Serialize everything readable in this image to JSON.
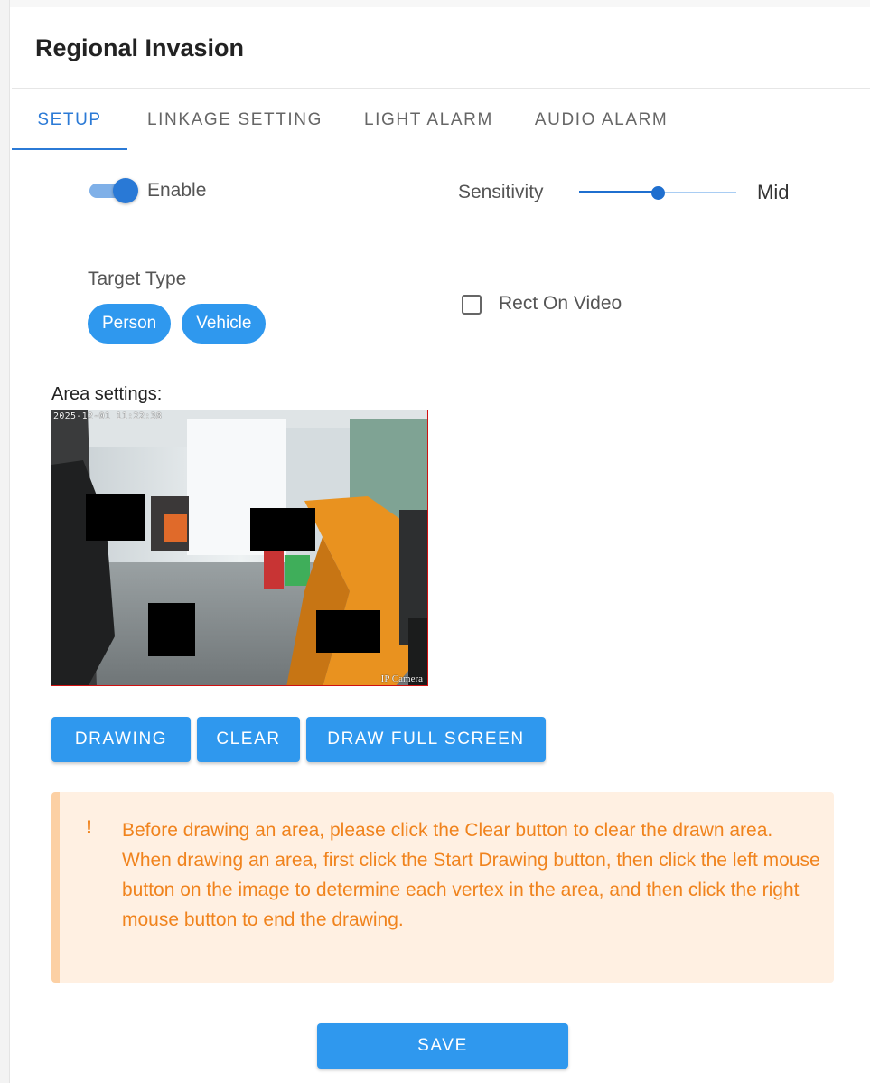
{
  "header": {
    "title": "Regional Invasion"
  },
  "tabs": [
    {
      "label": "SETUP",
      "active": true
    },
    {
      "label": "LINKAGE SETTING",
      "active": false
    },
    {
      "label": "LIGHT ALARM",
      "active": false
    },
    {
      "label": "AUDIO ALARM",
      "active": false
    }
  ],
  "setup": {
    "enable_label": "Enable",
    "enabled": true,
    "sensitivity_label": "Sensitivity",
    "sensitivity_value": "Mid",
    "sensitivity_level": 0.5,
    "target_type_label": "Target Type",
    "targets": [
      "Person",
      "Vehicle"
    ],
    "rect_on_video_label": "Rect On Video",
    "rect_on_video_checked": false,
    "area_settings_label": "Area settings:"
  },
  "video": {
    "timestamp": "2025-12-01 11:22:38",
    "camera_label": "IP Camera"
  },
  "buttons": {
    "drawing": "DRAWING",
    "clear": "CLEAR",
    "draw_full_screen": "DRAW FULL SCREEN",
    "save": "SAVE"
  },
  "alert": {
    "icon": "!",
    "line1": "Before drawing an area, please click the Clear button to clear the drawn area.",
    "line2": "When drawing an area, first click the Start Drawing button, then click the left mouse button on the image to determine each vertex in the area, and then click the right mouse button to end the drawing."
  },
  "colors": {
    "primary": "#2f98ee",
    "tab_active": "#2b7ad6",
    "alert_text": "#f0831d",
    "alert_bg": "#fff0e2",
    "area_border": "#d01010"
  }
}
